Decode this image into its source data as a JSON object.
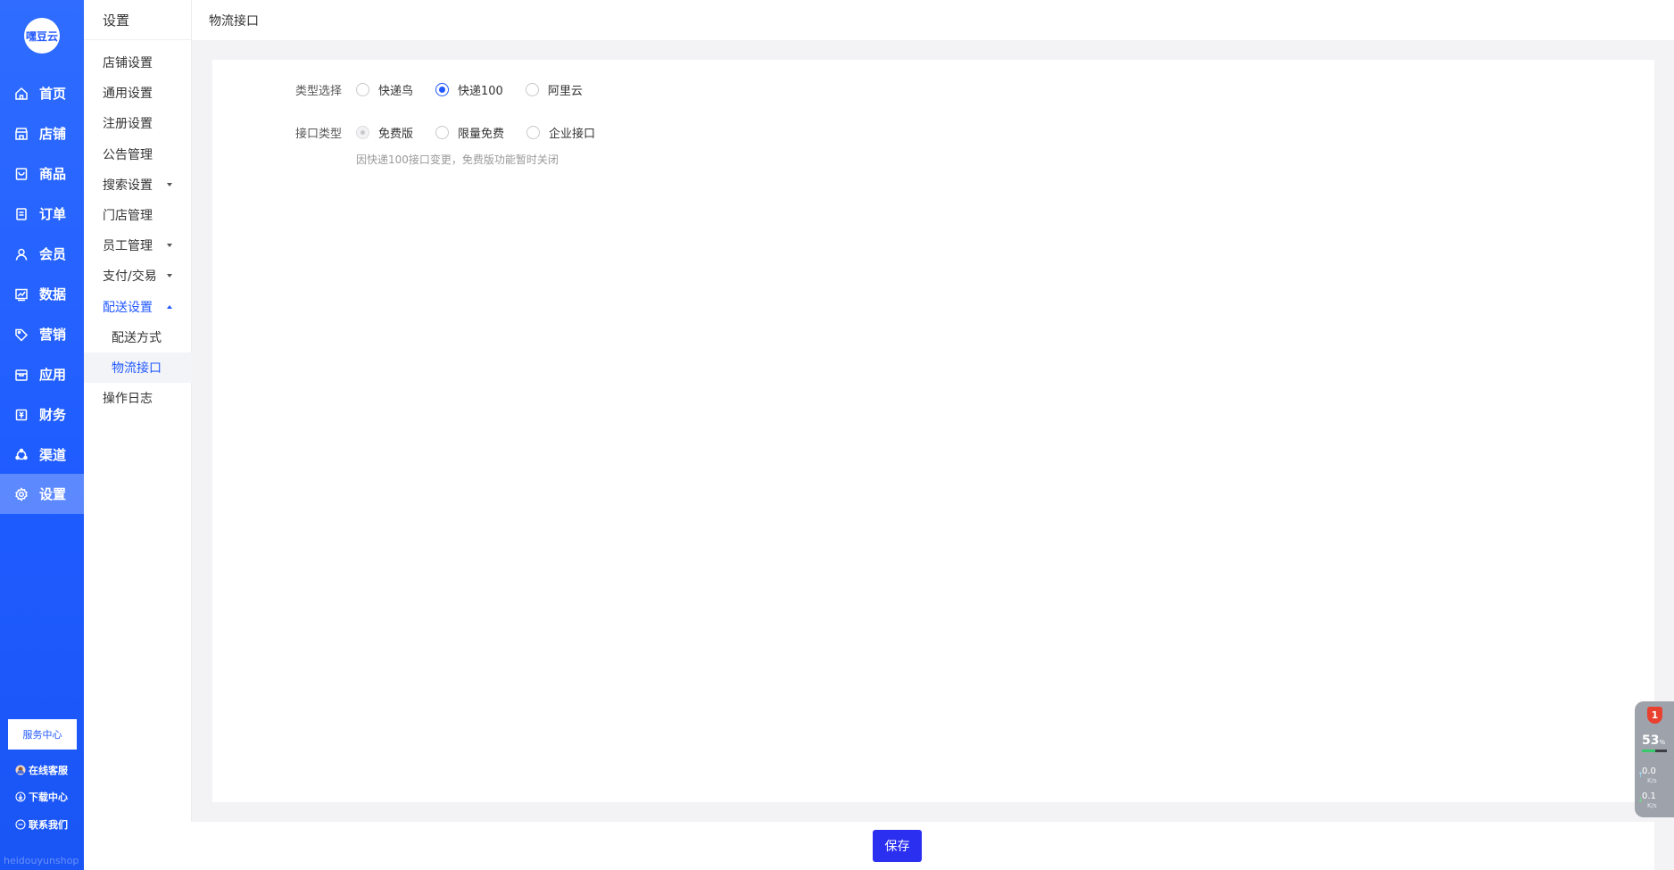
{
  "brand": {
    "logo_text": "嘿豆云",
    "watermark": "heidouyunshop"
  },
  "rail": {
    "items": [
      {
        "label": "首页",
        "icon": "home-icon"
      },
      {
        "label": "店铺",
        "icon": "store-icon"
      },
      {
        "label": "商品",
        "icon": "goods-icon"
      },
      {
        "label": "订单",
        "icon": "order-icon"
      },
      {
        "label": "会员",
        "icon": "user-icon"
      },
      {
        "label": "数据",
        "icon": "chart-icon"
      },
      {
        "label": "营销",
        "icon": "tag-icon"
      },
      {
        "label": "应用",
        "icon": "box-icon"
      },
      {
        "label": "财务",
        "icon": "finance-icon"
      },
      {
        "label": "渠道",
        "icon": "channel-icon"
      },
      {
        "label": "设置",
        "icon": "gear-icon",
        "active": true
      }
    ],
    "service_button": "服务中心",
    "links": [
      {
        "label": "在线客服",
        "icon": "avatar-icon"
      },
      {
        "label": "下载中心",
        "icon": "download-icon"
      },
      {
        "label": "联系我们",
        "icon": "chat-icon"
      }
    ]
  },
  "submenu": {
    "title": "设置",
    "items": [
      {
        "label": "店铺设置"
      },
      {
        "label": "通用设置"
      },
      {
        "label": "注册设置"
      },
      {
        "label": "公告管理"
      },
      {
        "label": "搜索设置",
        "expandable": true
      },
      {
        "label": "门店管理"
      },
      {
        "label": "员工管理",
        "expandable": true
      },
      {
        "label": "支付/交易",
        "expandable": true
      },
      {
        "label": "配送设置",
        "expandable": true,
        "open": true
      },
      {
        "label": "配送方式",
        "child": true
      },
      {
        "label": "物流接口",
        "child": true,
        "active": true
      },
      {
        "label": "操作日志"
      }
    ]
  },
  "breadcrumb": {
    "current": "物流接口"
  },
  "form": {
    "type_select": {
      "label": "类型选择",
      "options": [
        "快递鸟",
        "快递100",
        "阿里云"
      ],
      "selected": "快递100"
    },
    "interface_type": {
      "label": "接口类型",
      "options": [
        "免费版",
        "限量免费",
        "企业接口"
      ],
      "selected": "免费版",
      "selected_disabled": true,
      "hint": "因快递100接口变更，免费版功能暂时关闭"
    }
  },
  "footer": {
    "save_label": "保存"
  },
  "monitor": {
    "badge": "1",
    "cpu_percent": "53",
    "cpu_unit": "%",
    "cpu_level": 0.53,
    "up_speed": "0.0",
    "down_speed": "0.1",
    "speed_unit": "K/s"
  },
  "colors": {
    "accent": "#2158ff",
    "save_button": "#2b2ff0",
    "rail": "#1f5cff"
  }
}
